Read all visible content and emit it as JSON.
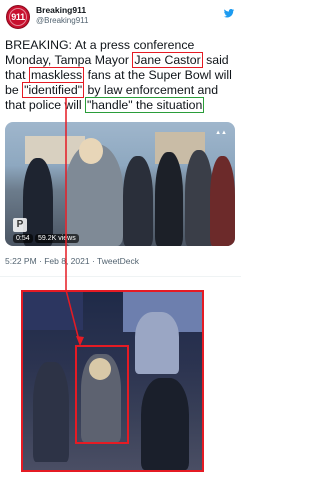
{
  "account": {
    "avatar_text": "911",
    "name": "Breaking911",
    "handle": "@Breaking911"
  },
  "tweet": {
    "p1": "BREAKING: At a press conference Monday, Tampa Mayor ",
    "h1": "Jane Castor",
    "p2": " said that ",
    "h2": "maskless",
    "p3": " fans at the Super Bowl will be ",
    "h3": "\"identified\"",
    "p4": " by law enforcement and that police will ",
    "h4": "\"handle\" the situation"
  },
  "video": {
    "duration": "0:54",
    "views": "59.2K views",
    "logo": "P"
  },
  "meta": {
    "text": "5:22 PM · Feb 8, 2021 · TweetDeck"
  },
  "colors": {
    "highlight_red": "#e51b24",
    "highlight_green": "#2a9d3a",
    "brand_red": "#c8102e",
    "twitter_blue": "#1d9bf0"
  },
  "icons": {
    "brand": "twitter-bird-icon"
  }
}
